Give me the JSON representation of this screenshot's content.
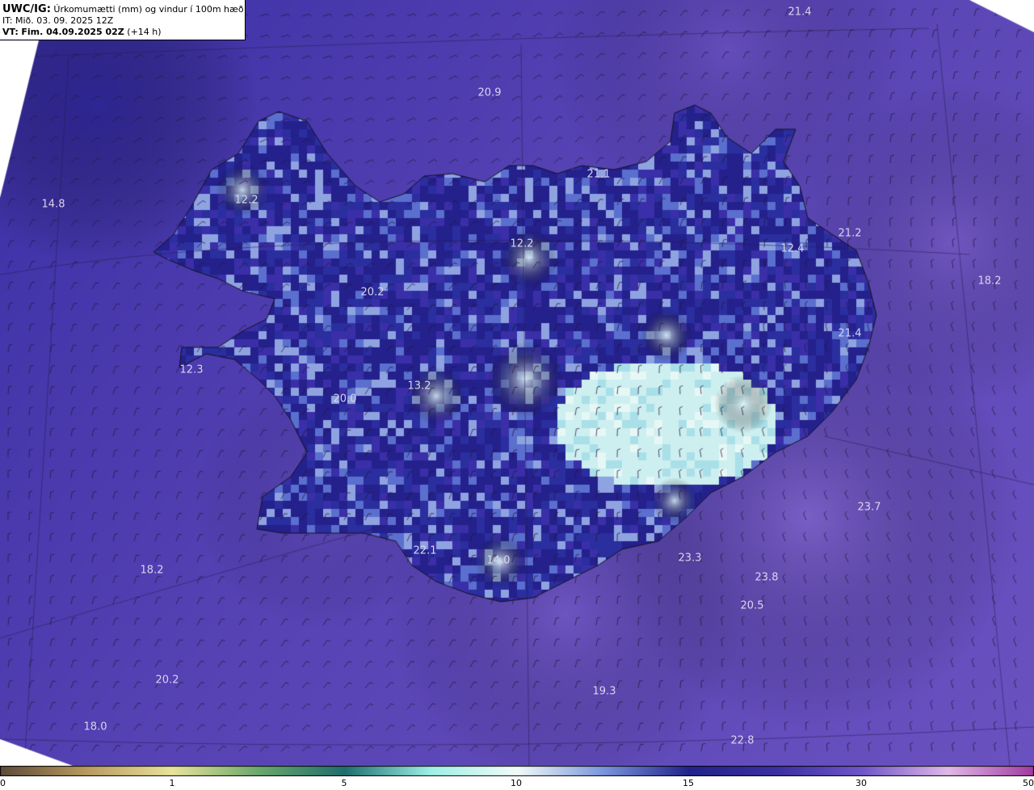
{
  "header": {
    "model_code": "UWC/IG:",
    "title": "Úrkomumætti (mm) og vindur í 100m hæð",
    "it_line": "IT: Mið. 03. 09. 2025 12Z",
    "vt_prefix": "VT:",
    "vt_date": "Fim. 04.09.2025 02Z",
    "vt_lead": "(+14 h)"
  },
  "colorbar": {
    "ticks": [
      "0",
      "1",
      "5",
      "10",
      "15",
      "30",
      "50"
    ],
    "colors": [
      "#5c4a3a",
      "#b89a5e",
      "#e8e49a",
      "#6aa86c",
      "#1f6e6e",
      "#9ef0e6",
      "#f2fbf8",
      "#7a96dc",
      "#22238a",
      "#3b30a0",
      "#6e55c8",
      "#e0b8e8",
      "#a03aa0"
    ]
  },
  "value_labels": [
    {
      "text": "21.4"
    },
    {
      "text": "20.9"
    },
    {
      "text": "14.8"
    },
    {
      "text": "12.2"
    },
    {
      "text": "21.1"
    },
    {
      "text": "12.2"
    },
    {
      "text": "21.2"
    },
    {
      "text": "12.4"
    },
    {
      "text": "18.2"
    },
    {
      "text": "20.2"
    },
    {
      "text": "21.4"
    },
    {
      "text": "12.3"
    },
    {
      "text": "13.2"
    },
    {
      "text": "20.0"
    },
    {
      "text": "23.7"
    },
    {
      "text": "22.1"
    },
    {
      "text": "23.3"
    },
    {
      "text": "18.2"
    },
    {
      "text": "14.0"
    },
    {
      "text": "23.8"
    },
    {
      "text": "20.5"
    },
    {
      "text": "20.2"
    },
    {
      "text": "19.3"
    },
    {
      "text": "18.0"
    },
    {
      "text": "22.8"
    }
  ]
}
